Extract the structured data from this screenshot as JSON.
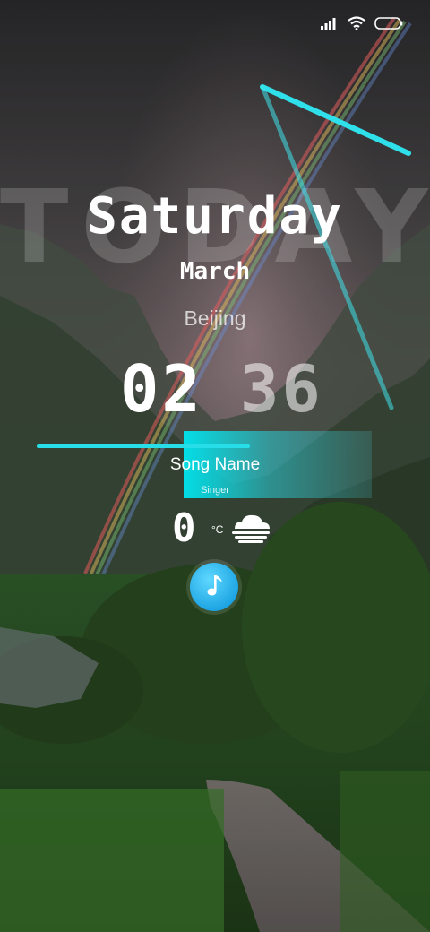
{
  "watermark": "TODAY'S",
  "date": {
    "day_of_week": "Saturday",
    "month": "March"
  },
  "location": {
    "city": "Beijing"
  },
  "clock": {
    "hours": "02",
    "minutes": "36"
  },
  "music": {
    "song_name": "Song Name",
    "singer": "Singer"
  },
  "weather": {
    "temperature": "0",
    "unit": "°C",
    "condition_icon": "fog-cloud-icon"
  },
  "status_bar": {
    "icons": [
      "signal-icon",
      "wifi-icon",
      "battery-icon"
    ]
  },
  "colors": {
    "accent": "#27dde8",
    "music_button": "#1fa6e4"
  }
}
